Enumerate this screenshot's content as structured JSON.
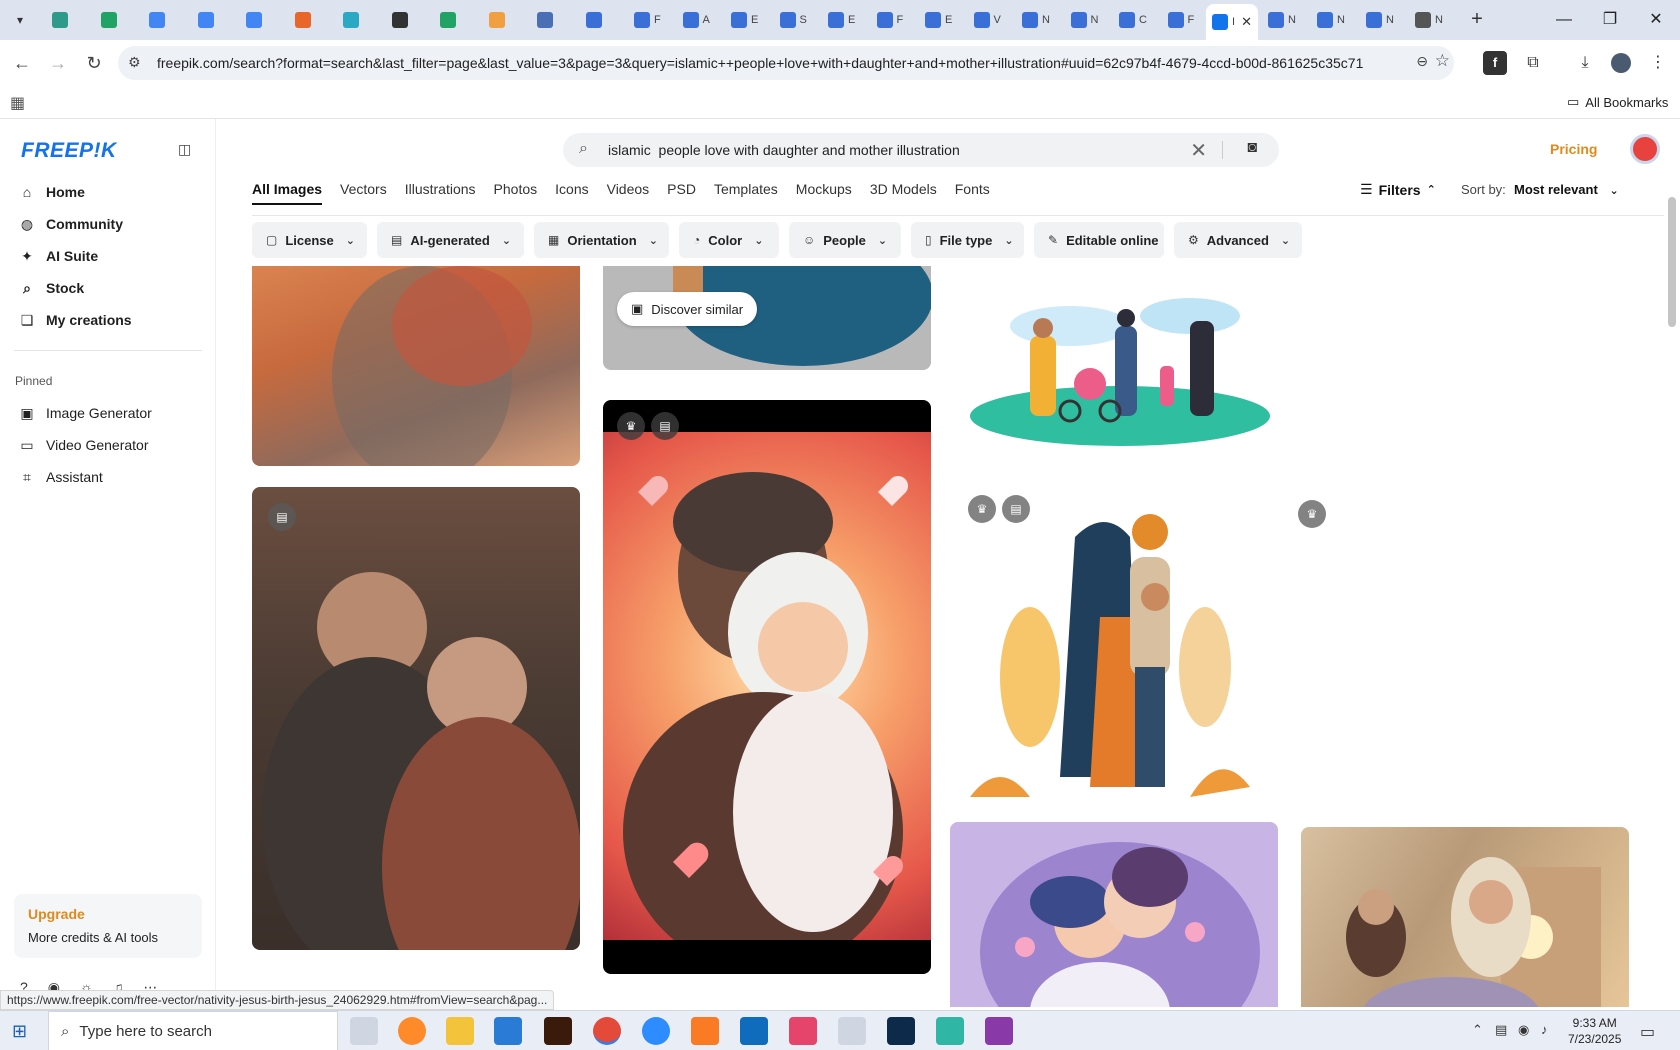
{
  "browser": {
    "active_tab_letter": "I",
    "tabs": [
      {
        "letter": "",
        "color": "#2f9a8a"
      },
      {
        "letter": "",
        "color": "#21a366"
      },
      {
        "letter": "",
        "color": "#4285f4"
      },
      {
        "letter": "",
        "color": "#4285f4"
      },
      {
        "letter": "",
        "color": "#4285f4"
      },
      {
        "letter": "",
        "color": "#e8662a"
      },
      {
        "letter": "",
        "color": "#2aa8c4"
      },
      {
        "letter": "",
        "color": "#333333"
      },
      {
        "letter": "",
        "color": "#21a366"
      },
      {
        "letter": "",
        "color": "#f0a040"
      },
      {
        "letter": "",
        "color": "#4a6fb5"
      },
      {
        "letter": "",
        "color": "#3a6fd8"
      },
      {
        "letter": "F",
        "color": "#3a6fd8"
      },
      {
        "letter": "A",
        "color": "#3a6fd8"
      },
      {
        "letter": "E",
        "color": "#3a6fd8"
      },
      {
        "letter": "S",
        "color": "#3a6fd8"
      },
      {
        "letter": "E",
        "color": "#3a6fd8"
      },
      {
        "letter": "F",
        "color": "#3a6fd8"
      },
      {
        "letter": "E",
        "color": "#3a6fd8"
      },
      {
        "letter": "V",
        "color": "#3a6fd8"
      },
      {
        "letter": "N",
        "color": "#3a6fd8"
      },
      {
        "letter": "N",
        "color": "#3a6fd8"
      },
      {
        "letter": "C",
        "color": "#3a6fd8"
      },
      {
        "letter": "F",
        "color": "#3a6fd8"
      }
    ],
    "tabs_after": [
      {
        "letter": "N",
        "color": "#3a6fd8"
      },
      {
        "letter": "N",
        "color": "#3a6fd8"
      },
      {
        "letter": "N",
        "color": "#3a6fd8"
      },
      {
        "letter": "N",
        "color": "#555555"
      }
    ],
    "url": "freepik.com/search?format=search&last_filter=page&last_value=3&page=3&query=islamic++people+love+with+daughter+and+mother+illustration#uuid=62c97b4f-4679-4ccd-b00d-861625c35c71",
    "bookmarks_label": "All Bookmarks"
  },
  "sidebar": {
    "logo": "FREEP!K",
    "items": [
      {
        "label": "Home",
        "icon": "home-icon",
        "glyph": "⌂"
      },
      {
        "label": "Community",
        "icon": "globe-icon",
        "glyph": "◍"
      },
      {
        "label": "AI Suite",
        "icon": "sparkle-icon",
        "glyph": "✦"
      },
      {
        "label": "Stock",
        "icon": "search-icon",
        "glyph": "⌕"
      },
      {
        "label": "My creations",
        "icon": "stack-icon",
        "glyph": "❏"
      }
    ],
    "pinned_label": "Pinned",
    "pinned": [
      {
        "label": "Image Generator",
        "icon": "image-icon",
        "glyph": "▣"
      },
      {
        "label": "Video Generator",
        "icon": "video-icon",
        "glyph": "▭"
      },
      {
        "label": "Assistant",
        "icon": "chat-icon",
        "glyph": "⌗"
      }
    ],
    "upgrade_title": "Upgrade",
    "upgrade_sub": "More credits & AI tools"
  },
  "search": {
    "query": "islamic  people love with daughter and mother illustration",
    "pricing": "Pricing"
  },
  "categories": [
    "All Images",
    "Vectors",
    "Illustrations",
    "Photos",
    "Icons",
    "Videos",
    "PSD",
    "Templates",
    "Mockups",
    "3D Models",
    "Fonts"
  ],
  "filters_label": "Filters",
  "sort_label": "Sort by:",
  "sort_value": "Most relevant",
  "filter_chips": [
    {
      "label": "License",
      "icon": "license-icon"
    },
    {
      "label": "AI-generated",
      "icon": "ai-icon"
    },
    {
      "label": "Orientation",
      "icon": "orientation-icon"
    },
    {
      "label": "Color",
      "icon": "palette-icon"
    },
    {
      "label": "People",
      "icon": "people-icon"
    },
    {
      "label": "File type",
      "icon": "file-icon"
    },
    {
      "label": "Editable online",
      "icon": "pencil-icon"
    },
    {
      "label": "Advanced",
      "icon": "gear-icon"
    }
  ],
  "discover_similar": "Discover similar",
  "status_url": "https://www.freepik.com/free-vector/nativity-jesus-birth-jesus_24062929.htm#fromView=search&pag...",
  "taskbar": {
    "search_placeholder": "Type here to search",
    "time": "9:33 AM",
    "date": "7/23/2025"
  }
}
